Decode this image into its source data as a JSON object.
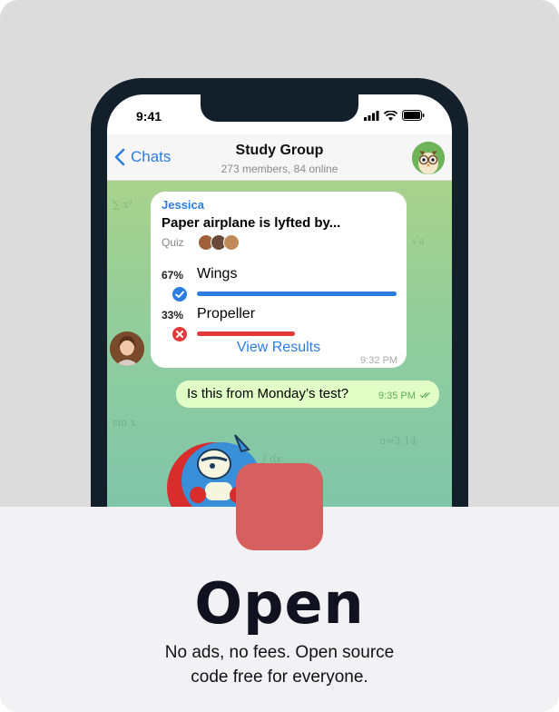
{
  "status": {
    "time": "9:41"
  },
  "header": {
    "back_label": "Chats",
    "title": "Study Group",
    "subtitle": "273 members, 84 online"
  },
  "poll": {
    "author": "Jessica",
    "question": "Paper airplane is lyfted by...",
    "type_label": "Quiz",
    "options": [
      {
        "percent_label": "67%",
        "label": "Wings",
        "percent": 67,
        "status": "correct",
        "color": "#2b7de0"
      },
      {
        "percent_label": "33%",
        "label": "Propeller",
        "percent": 33,
        "status": "wrong",
        "color": "#e03a3a"
      }
    ],
    "view_results": "View Results",
    "time": "9:32 PM"
  },
  "message": {
    "text": "Is this from Monday’s test?",
    "time": "9:35 PM"
  },
  "promo": {
    "headline": "Open",
    "body_line1": "No ads, no fees. Open source",
    "body_line2": "code free for everyone."
  },
  "colors": {
    "accent": "#2b7de0",
    "app_icon": "#d65f5f",
    "outgoing_bubble": "#e1fec6"
  }
}
